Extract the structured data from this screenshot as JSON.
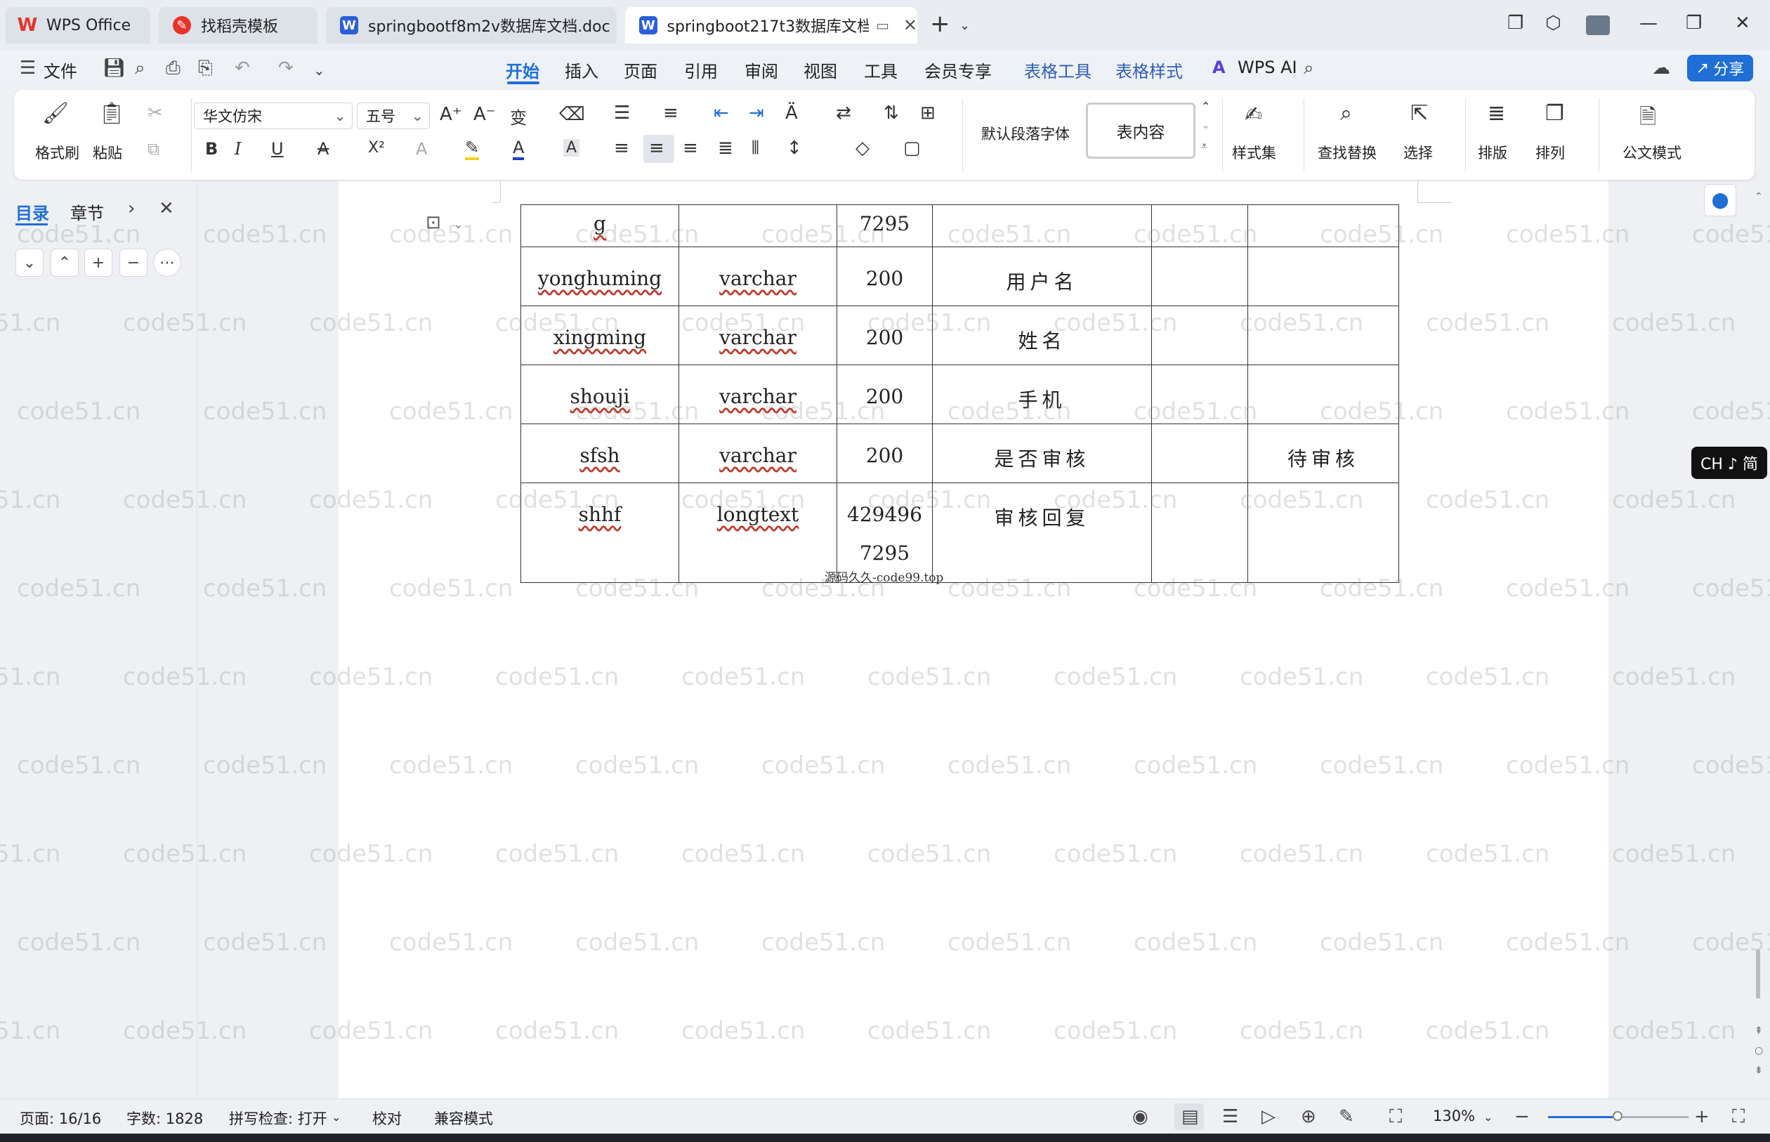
{
  "tabs": [
    {
      "label": "WPS Office",
      "icon": "wps-logo-icon",
      "color": "#e8332a"
    },
    {
      "label": "找稻壳模板",
      "icon": "docer-icon",
      "color": "#e8332a"
    },
    {
      "label": "springbootf8m2v数据库文档.doc",
      "icon": "word-doc-icon",
      "color": "#2b5fd9"
    },
    {
      "label": "springboot217t3数据库文档",
      "icon": "word-doc-icon",
      "color": "#2b5fd9"
    }
  ],
  "menu": {
    "file": "文件",
    "items": [
      "开始",
      "插入",
      "页面",
      "引用",
      "审阅",
      "视图",
      "工具",
      "会员专享"
    ],
    "active": "开始",
    "context_items": [
      "表格工具",
      "表格样式"
    ],
    "wps_ai": "WPS AI",
    "share": "分享"
  },
  "ribbon": {
    "format_painter": "格式刷",
    "paste": "粘贴",
    "font_name": "华文仿宋",
    "font_size": "五号",
    "style_default": "默认段落字体",
    "style_current": "表内容",
    "styles_set": "样式集",
    "find_replace": "查找替换",
    "select": "选择",
    "layout": "排版",
    "arrange": "排列",
    "official_mode": "公文模式"
  },
  "nav": {
    "toc": "目录",
    "chapter": "章节"
  },
  "table": {
    "rows": [
      [
        "g",
        "",
        "7295",
        "",
        "",
        ""
      ],
      [
        "yonghuming",
        "varchar",
        "200",
        "用户名",
        "",
        ""
      ],
      [
        "xingming",
        "varchar",
        "200",
        "姓名",
        "",
        ""
      ],
      [
        "shouji",
        "varchar",
        "200",
        "手机",
        "",
        ""
      ],
      [
        "sfsh",
        "varchar",
        "200",
        "是否审核",
        "",
        "待审核"
      ],
      [
        "shhf",
        "longtext",
        "429496",
        "审核回复",
        "",
        ""
      ]
    ],
    "last_row_extra": "7295",
    "footer_text": "源码久久-code99.top"
  },
  "ime": "CH ♪ 简",
  "status": {
    "page": "页面: 16/16",
    "words": "字数: 1828",
    "spell": "拼写检查: 打开",
    "proof": "校对",
    "compat": "兼容模式",
    "zoom": "130%"
  },
  "watermark": "code51.cn",
  "colors": {
    "accent": "#1f6fd6",
    "context_tab": "#2f5fb3",
    "share_bg": "#1f6fd6"
  }
}
